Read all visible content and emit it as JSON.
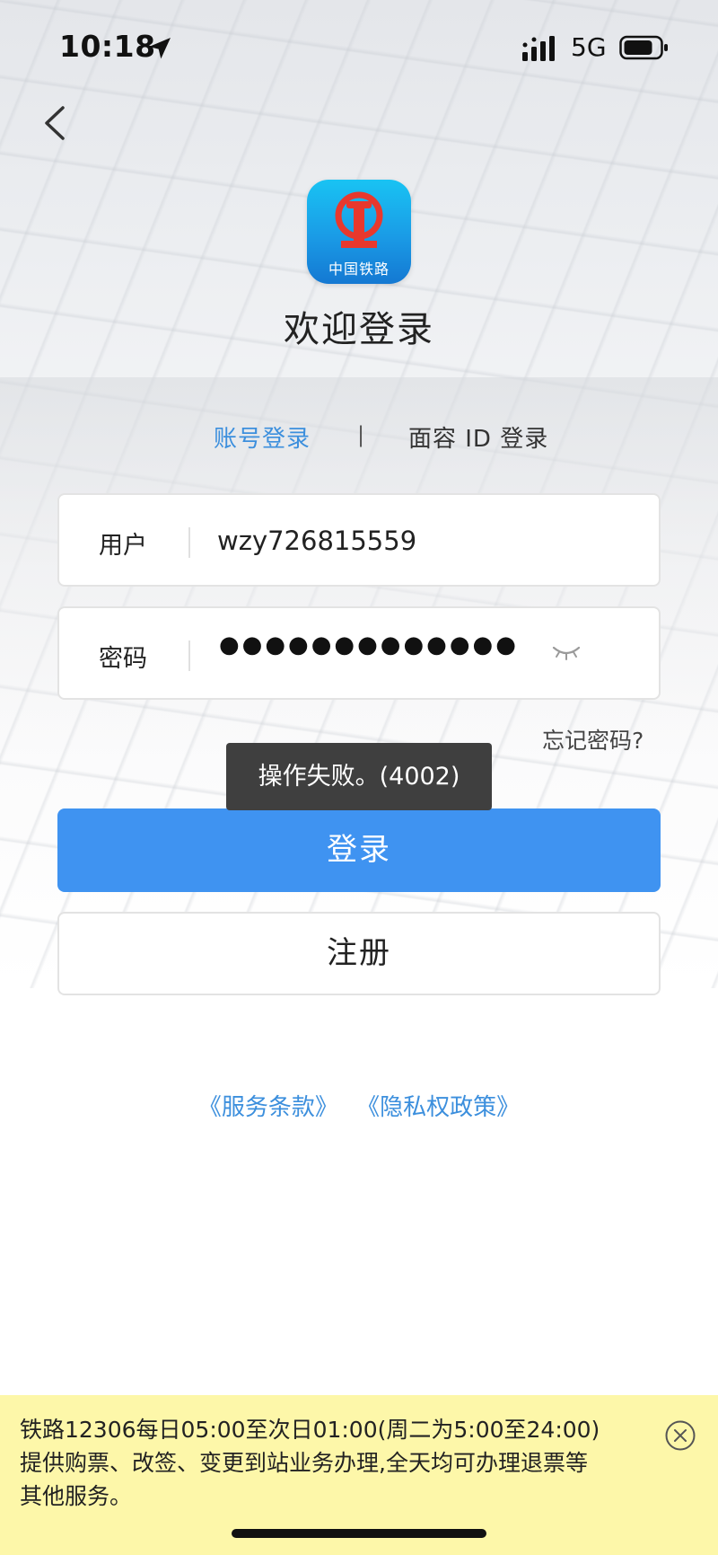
{
  "status_bar": {
    "time": "10:18",
    "network": "5G",
    "icons": [
      "location-arrow-icon",
      "signal-icon",
      "battery-icon"
    ]
  },
  "navigation": {
    "back_icon": "chevron-left-icon"
  },
  "logo": {
    "text": "中国铁路",
    "icon": "china-railway-emblem-icon"
  },
  "header": {
    "title": "欢迎登录"
  },
  "tabs": {
    "account_login": "账号登录",
    "separator": "|",
    "face_id_login": "面容 ID 登录",
    "active_color": "#3c8fdd"
  },
  "form": {
    "user_label": "用户",
    "user_value": "wzy726815559",
    "password_label": "密码",
    "password_mask": "●●●●●●●●●●●●●",
    "eye_icon": "eye-closed-icon",
    "forgot_password": "忘记密码?"
  },
  "toast": {
    "message": "操作失败。(4002)"
  },
  "buttons": {
    "login": "登录",
    "register": "注册",
    "login_color": "#3f93f1"
  },
  "footer_links": {
    "terms": "《服务条款》",
    "privacy": "《隐私权政策》"
  },
  "notice": {
    "line1": "铁路12306每日05:00至次日01:00(周二为5:00至24:00)",
    "line2": "提供购票、改签、变更到站业务办理,全天均可办理退票等",
    "line3": "其他服务。",
    "close_icon": "close-circle-icon",
    "background": "#fdf7a9"
  }
}
